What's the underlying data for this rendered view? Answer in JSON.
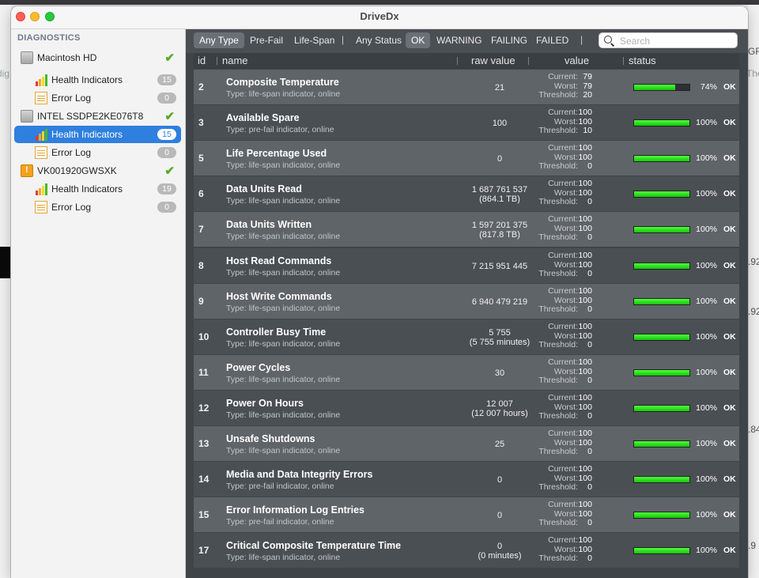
{
  "window_title": "DriveDx",
  "background_text": {
    "right_top": "GRA",
    "right_top2": "The",
    "left_top": "dig",
    "right_n1": ".92",
    "right_n2": ".92",
    "right_n3": ".84",
    "right_n4": ".9"
  },
  "sidebar": {
    "heading": "DIAGNOSTICS",
    "items": [
      {
        "label": "Macintosh HD",
        "kind": "disk",
        "status": "check"
      },
      {
        "label": "Health Indicators",
        "kind": "health",
        "badge": "15"
      },
      {
        "label": "Error Log",
        "kind": "log",
        "badge": "0"
      },
      {
        "label": "INTEL SSDPE2KE076T8",
        "kind": "disk",
        "status": "check"
      },
      {
        "label": "Health Indicators",
        "kind": "health",
        "badge": "15",
        "selected": true
      },
      {
        "label": "Error Log",
        "kind": "log",
        "badge": "0"
      },
      {
        "label": "VK001920GWSXK",
        "kind": "disk-warn",
        "status": "check"
      },
      {
        "label": "Health Indicators",
        "kind": "health",
        "badge": "19"
      },
      {
        "label": "Error Log",
        "kind": "log",
        "badge": "0"
      }
    ]
  },
  "filters": {
    "any_type": "Any Type",
    "pre_fail": "Pre-Fail",
    "life_span": "Life-Span",
    "any_status": "Any Status",
    "ok": "OK",
    "warning": "WARNING",
    "failing": "FAILING",
    "failed": "FAILED",
    "sep": "|"
  },
  "search": {
    "placeholder": "Search"
  },
  "columns": {
    "id": "id",
    "name": "name",
    "raw": "raw value",
    "value": "value",
    "status": "status"
  },
  "value_labels": {
    "current": "Current:",
    "worst": "Worst:",
    "threshold": "Threshold:"
  },
  "rows": [
    {
      "id": "2",
      "name": "Composite Temperature",
      "type": "Type: life-span indicator, online",
      "raw": "21",
      "raw2": "",
      "current": "79",
      "worst": "79",
      "threshold": "20",
      "percent": 74,
      "percent_label": "74%",
      "status": "OK"
    },
    {
      "id": "3",
      "name": "Available Spare",
      "type": "Type: pre-fail indicator, online",
      "raw": "100",
      "raw2": "",
      "current": "100",
      "worst": "100",
      "threshold": "10",
      "percent": 100,
      "percent_label": "100%",
      "status": "OK"
    },
    {
      "id": "5",
      "name": "Life Percentage Used",
      "type": "Type: life-span indicator, online",
      "raw": "0",
      "raw2": "",
      "current": "100",
      "worst": "100",
      "threshold": "0",
      "percent": 100,
      "percent_label": "100%",
      "status": "OK"
    },
    {
      "id": "6",
      "name": "Data Units Read",
      "type": "Type: life-span indicator, online",
      "raw": "1 687 761 537",
      "raw2": "(864.1 TB)",
      "current": "100",
      "worst": "100",
      "threshold": "0",
      "percent": 100,
      "percent_label": "100%",
      "status": "OK"
    },
    {
      "id": "7",
      "name": "Data Units Written",
      "type": "Type: life-span indicator, online",
      "raw": "1 597 201 375",
      "raw2": "(817.8 TB)",
      "current": "100",
      "worst": "100",
      "threshold": "0",
      "percent": 100,
      "percent_label": "100%",
      "status": "OK"
    },
    {
      "id": "8",
      "name": "Host Read Commands",
      "type": "Type: life-span indicator, online",
      "raw": "7 215 951 445",
      "raw2": "",
      "current": "100",
      "worst": "100",
      "threshold": "0",
      "percent": 100,
      "percent_label": "100%",
      "status": "OK"
    },
    {
      "id": "9",
      "name": "Host Write Commands",
      "type": "Type: life-span indicator, online",
      "raw": "6 940 479 219",
      "raw2": "",
      "current": "100",
      "worst": "100",
      "threshold": "0",
      "percent": 100,
      "percent_label": "100%",
      "status": "OK"
    },
    {
      "id": "10",
      "name": "Controller Busy Time",
      "type": "Type: life-span indicator, online",
      "raw": "5 755",
      "raw2": "(5 755 minutes)",
      "current": "100",
      "worst": "100",
      "threshold": "0",
      "percent": 100,
      "percent_label": "100%",
      "status": "OK"
    },
    {
      "id": "11",
      "name": "Power Cycles",
      "type": "Type: life-span indicator, online",
      "raw": "30",
      "raw2": "",
      "current": "100",
      "worst": "100",
      "threshold": "0",
      "percent": 100,
      "percent_label": "100%",
      "status": "OK"
    },
    {
      "id": "12",
      "name": "Power On Hours",
      "type": "Type: life-span indicator, online",
      "raw": "12 007",
      "raw2": "(12 007 hours)",
      "current": "100",
      "worst": "100",
      "threshold": "0",
      "percent": 100,
      "percent_label": "100%",
      "status": "OK"
    },
    {
      "id": "13",
      "name": "Unsafe Shutdowns",
      "type": "Type: life-span indicator, online",
      "raw": "25",
      "raw2": "",
      "current": "100",
      "worst": "100",
      "threshold": "0",
      "percent": 100,
      "percent_label": "100%",
      "status": "OK"
    },
    {
      "id": "14",
      "name": "Media and Data Integrity Errors",
      "type": "Type: pre-fail indicator, online",
      "raw": "0",
      "raw2": "",
      "current": "100",
      "worst": "100",
      "threshold": "0",
      "percent": 100,
      "percent_label": "100%",
      "status": "OK"
    },
    {
      "id": "15",
      "name": "Error Information Log Entries",
      "type": "Type: pre-fail indicator, online",
      "raw": "0",
      "raw2": "",
      "current": "100",
      "worst": "100",
      "threshold": "0",
      "percent": 100,
      "percent_label": "100%",
      "status": "OK"
    },
    {
      "id": "17",
      "name": "Critical Composite Temperature Time",
      "type": "Type: life-span indicator, online",
      "raw": "0",
      "raw2": "(0 minutes)",
      "current": "100",
      "worst": "100",
      "threshold": "0",
      "percent": 100,
      "percent_label": "100%",
      "status": "OK"
    }
  ]
}
